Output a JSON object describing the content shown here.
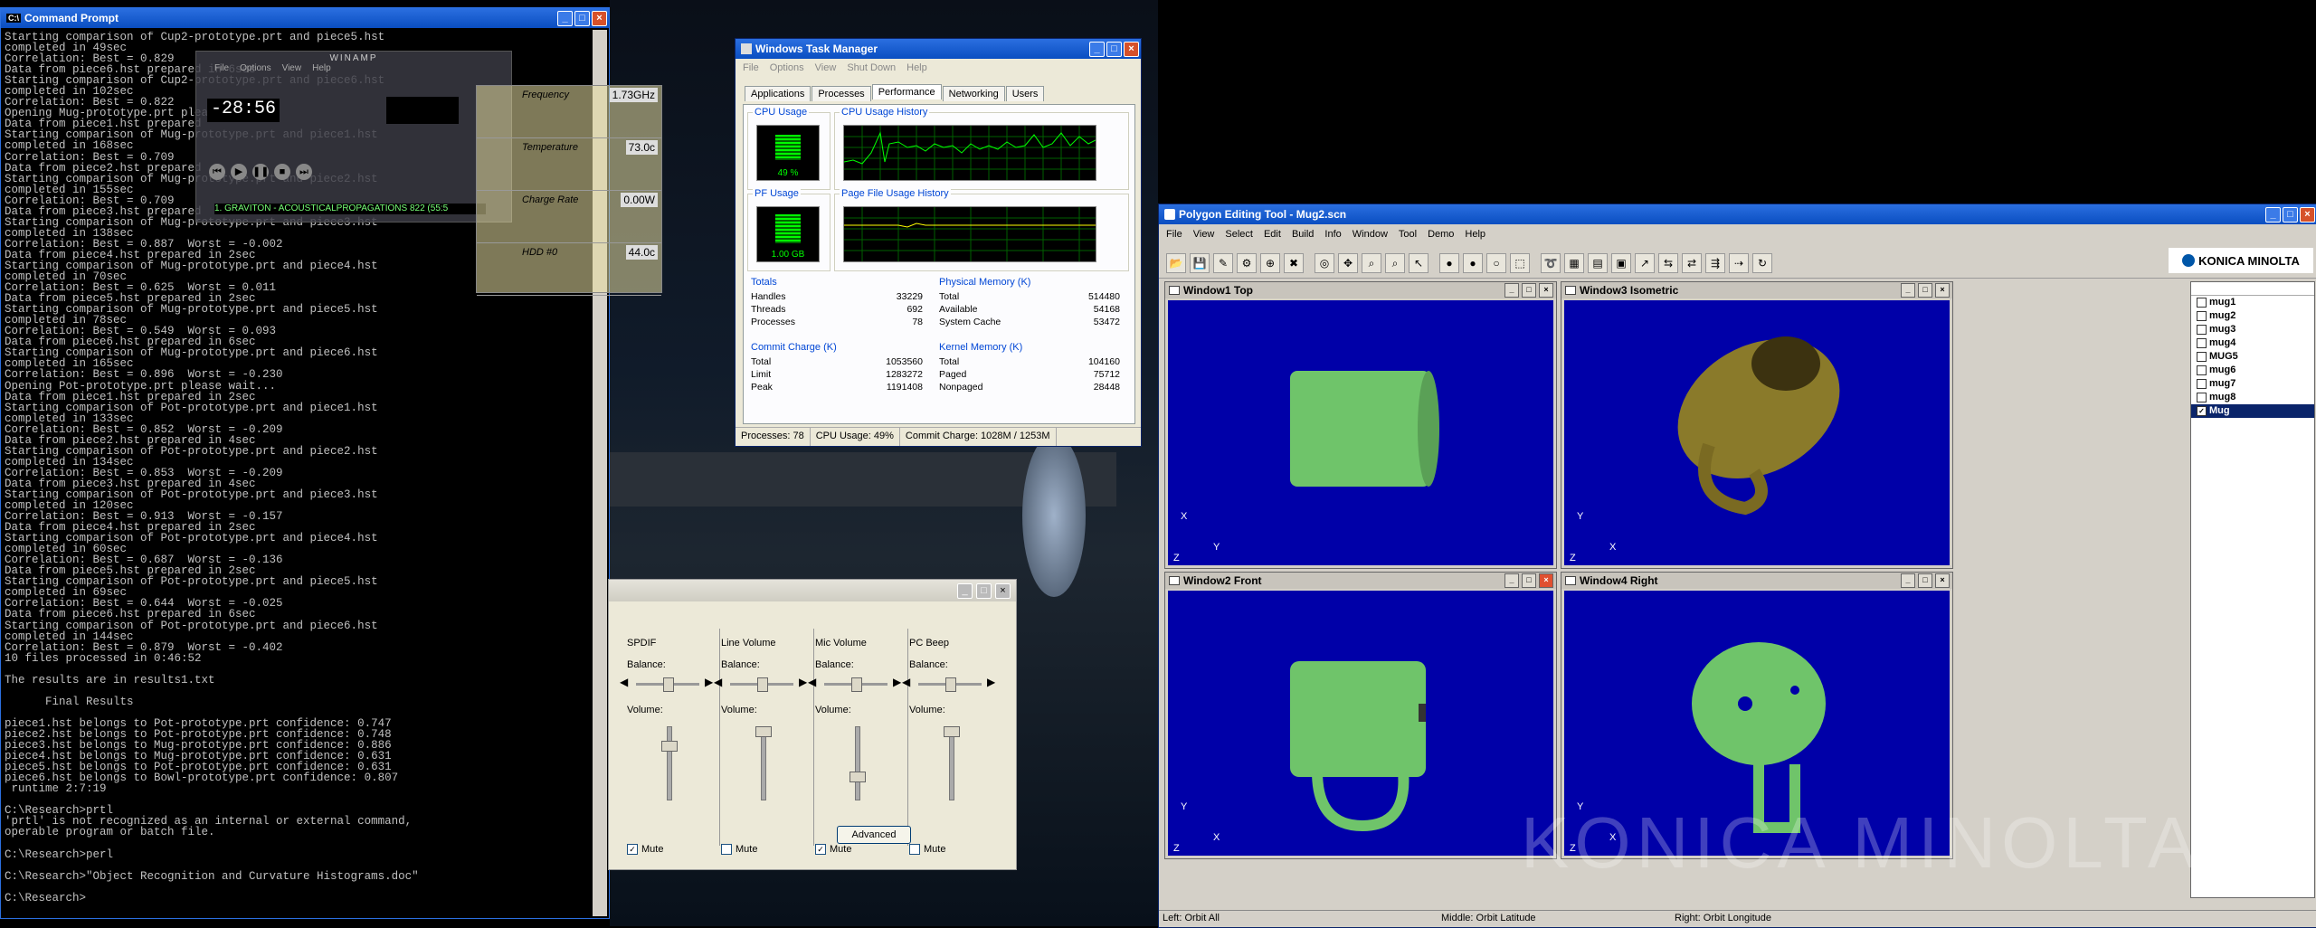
{
  "cmd": {
    "title": "Command Prompt",
    "lines": [
      "Starting comparison of Cup2-prototype.prt and piece5.hst",
      "completed in 49sec",
      "Correlation: Best = 0.829",
      "Data from piece6.hst prepared in 6sec",
      "Starting comparison of Cup2-prototype.prt and piece6.hst",
      "completed in 102sec",
      "Correlation: Best = 0.822",
      "Opening Mug-prototype.prt please",
      "Data from piece1.hst prepared",
      "Starting comparison of Mug-prototype.prt and piece1.hst",
      "completed in 168sec",
      "Correlation: Best = 0.709",
      "Data from piece2.hst prepared",
      "Starting comparison of Mug-prototype.prt and piece2.hst",
      "completed in 155sec",
      "Correlation: Best = 0.709",
      "Data from piece3.hst prepared",
      "Starting comparison of Mug-prototype.prt and piece3.hst",
      "completed in 138sec",
      "Correlation: Best = 0.887  Worst = -0.002",
      "Data from piece4.hst prepared in 2sec",
      "Starting comparison of Mug-prototype.prt and piece4.hst",
      "completed in 70sec",
      "Correlation: Best = 0.625  Worst = 0.011",
      "Data from piece5.hst prepared in 2sec",
      "Starting comparison of Mug-prototype.prt and piece5.hst",
      "completed in 78sec",
      "Correlation: Best = 0.549  Worst = 0.093",
      "Data from piece6.hst prepared in 6sec",
      "Starting comparison of Mug-prototype.prt and piece6.hst",
      "completed in 165sec",
      "Correlation: Best = 0.896  Worst = -0.230",
      "Opening Pot-prototype.prt please wait...",
      "Data from piece1.hst prepared in 2sec",
      "Starting comparison of Pot-prototype.prt and piece1.hst",
      "completed in 133sec",
      "Correlation: Best = 0.852  Worst = -0.209",
      "Data from piece2.hst prepared in 4sec",
      "Starting comparison of Pot-prototype.prt and piece2.hst",
      "completed in 134sec",
      "Correlation: Best = 0.853  Worst = -0.209",
      "Data from piece3.hst prepared in 4sec",
      "Starting comparison of Pot-prototype.prt and piece3.hst",
      "completed in 120sec",
      "Correlation: Best = 0.913  Worst = -0.157",
      "Data from piece4.hst prepared in 2sec",
      "Starting comparison of Pot-prototype.prt and piece4.hst",
      "completed in 60sec",
      "Correlation: Best = 0.687  Worst = -0.136",
      "Data from piece5.hst prepared in 2sec",
      "Starting comparison of Pot-prototype.prt and piece5.hst",
      "completed in 69sec",
      "Correlation: Best = 0.644  Worst = -0.025",
      "Data from piece6.hst prepared in 6sec",
      "Starting comparison of Pot-prototype.prt and piece6.hst",
      "completed in 144sec",
      "Correlation: Best = 0.879  Worst = -0.402",
      "10 files processed in 0:46:52",
      "",
      "The results are in results1.txt",
      "",
      "      Final Results",
      "",
      "piece1.hst belongs to Pot-prototype.prt confidence: 0.747",
      "piece2.hst belongs to Pot-prototype.prt confidence: 0.748",
      "piece3.hst belongs to Mug-prototype.prt confidence: 0.886",
      "piece4.hst belongs to Mug-prototype.prt confidence: 0.631",
      "piece5.hst belongs to Pot-prototype.prt confidence: 0.631",
      "piece6.hst belongs to Bowl-prototype.prt confidence: 0.807",
      " runtime 2:7:19",
      "",
      "C:\\Research>prtl",
      "'prtl' is not recognized as an internal or external command,",
      "operable program or batch file.",
      "",
      "C:\\Research>perl",
      "",
      "C:\\Research>\"Object Recognition and Curvature Histograms.doc\"",
      "",
      "C:\\Research>"
    ]
  },
  "winamp": {
    "title": "WINAMP",
    "time": "-28:56",
    "track": "1. GRAVITON - ACOUSTICALPROPAGATIONS 822 (55:5",
    "menu": [
      "File",
      "Options",
      "View",
      "Help"
    ]
  },
  "monitor": {
    "rows": [
      {
        "label": "Frequency",
        "value": "1.73GHz"
      },
      {
        "label": "Temperature",
        "value": "73.0c"
      },
      {
        "label": "Charge Rate",
        "value": "0.00W"
      },
      {
        "label": "HDD #0",
        "value": "44.0c"
      }
    ]
  },
  "taskmgr": {
    "title": "Windows Task Manager",
    "menu": [
      "File",
      "Options",
      "View",
      "Shut Down",
      "Help"
    ],
    "tabs": [
      "Applications",
      "Processes",
      "Performance",
      "Networking",
      "Users"
    ],
    "cpu_usage_label": "CPU Usage",
    "cpu_usage_value": "49 %",
    "cpu_history_label": "CPU Usage History",
    "pf_usage_label": "PF Usage",
    "pf_usage_value": "1.00 GB",
    "pf_history_label": "Page File Usage History",
    "totals": {
      "label": "Totals",
      "rows": [
        [
          "Handles",
          "33229"
        ],
        [
          "Threads",
          "692"
        ],
        [
          "Processes",
          "78"
        ]
      ]
    },
    "physical": {
      "label": "Physical Memory (K)",
      "rows": [
        [
          "Total",
          "514480"
        ],
        [
          "Available",
          "54168"
        ],
        [
          "System Cache",
          "53472"
        ]
      ]
    },
    "commit": {
      "label": "Commit Charge (K)",
      "rows": [
        [
          "Total",
          "1053560"
        ],
        [
          "Limit",
          "1283272"
        ],
        [
          "Peak",
          "1191408"
        ]
      ]
    },
    "kernel": {
      "label": "Kernel Memory (K)",
      "rows": [
        [
          "Total",
          "104160"
        ],
        [
          "Paged",
          "75712"
        ],
        [
          "Nonpaged",
          "28448"
        ]
      ]
    },
    "status": [
      "Processes: 78",
      "CPU Usage: 49%",
      "Commit Charge: 1028M / 1253M"
    ]
  },
  "volume": {
    "channels": [
      {
        "name": "SPDIF",
        "mute": true,
        "mute_label": "Mute"
      },
      {
        "name": "Line Volume",
        "mute": false,
        "mute_label": "Mute"
      },
      {
        "name": "Mic Volume",
        "mute": true,
        "mute_label": "Mute"
      },
      {
        "name": "PC Beep",
        "mute": false,
        "mute_label": "Mute"
      }
    ],
    "balance_label": "Balance:",
    "volume_label": "Volume:",
    "advanced_label": "Advanced"
  },
  "pet": {
    "title": "Polygon Editing Tool - Mug2.scn",
    "menu": [
      "File",
      "View",
      "Select",
      "Edit",
      "Build",
      "Info",
      "Window",
      "Tool",
      "Demo",
      "Help"
    ],
    "brand": "KONICA MINOLTA",
    "viewports": [
      {
        "title": "Window1 Top",
        "axes": [
          "X",
          "Y",
          "Z"
        ]
      },
      {
        "title": "Window3 Isometric",
        "axes": [
          "Y",
          "X",
          "Z"
        ]
      },
      {
        "title": "Window2 Front",
        "axes": [
          "Y",
          "X",
          "Z"
        ]
      },
      {
        "title": "Window4 Right",
        "axes": [
          "Y",
          "X",
          "Z"
        ]
      }
    ],
    "objects": [
      {
        "name": "mug1",
        "checked": false
      },
      {
        "name": "mug2",
        "checked": false
      },
      {
        "name": "mug3",
        "checked": false
      },
      {
        "name": "mug4",
        "checked": false
      },
      {
        "name": "MUG5",
        "checked": false
      },
      {
        "name": "mug6",
        "checked": false
      },
      {
        "name": "mug7",
        "checked": false
      },
      {
        "name": "mug8",
        "checked": false
      },
      {
        "name": "Mug",
        "checked": true
      }
    ],
    "status": [
      "Left: Orbit All",
      "Middle: Orbit Latitude",
      "Right: Orbit Longitude"
    ]
  },
  "colors": {
    "viewport_bg": "#0000a8",
    "mesh_green": "#6fc46a",
    "titlebar": "#0a4ec1"
  }
}
